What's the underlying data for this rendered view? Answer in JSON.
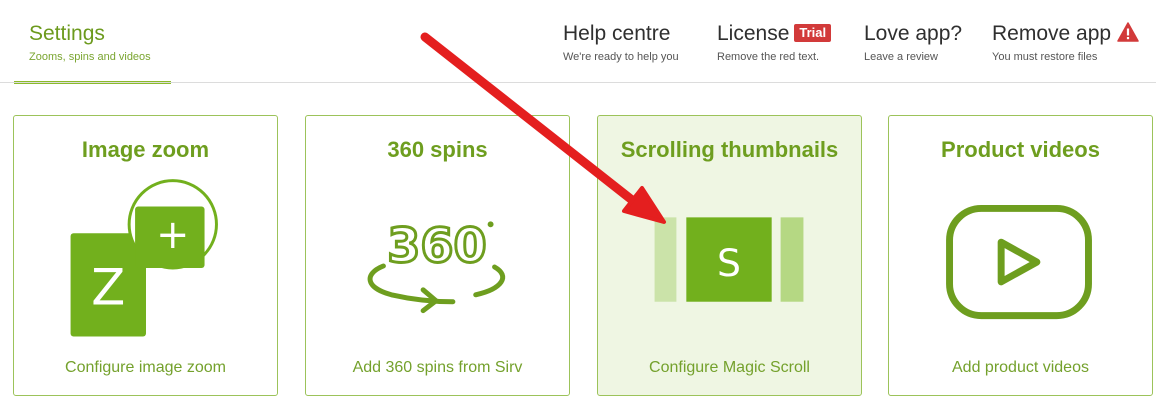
{
  "header": {
    "settings": {
      "title": "Settings",
      "subtitle": "Zooms, spins and videos"
    },
    "help": {
      "title": "Help centre",
      "subtitle": "We're ready to help you"
    },
    "license": {
      "title": "License",
      "badge": "Trial",
      "subtitle": "Remove the red text."
    },
    "love": {
      "title": "Love app?",
      "subtitle": "Leave a review"
    },
    "remove": {
      "title": "Remove app",
      "icon": "warning-icon",
      "subtitle": "You must restore files"
    }
  },
  "cards": [
    {
      "title": "Image zoom",
      "icon": "zoom-icon",
      "icon_letter": "Z",
      "icon_symbol": "+",
      "link": "Configure image zoom"
    },
    {
      "title": "360 spins",
      "icon": "spin-360-icon",
      "icon_text": "360",
      "link": "Add 360 spins from Sirv"
    },
    {
      "title": "Scrolling thumbnails",
      "icon": "scroll-thumbnails-icon",
      "icon_letter": "S",
      "link": "Configure Magic Scroll",
      "selected": true
    },
    {
      "title": "Product videos",
      "icon": "video-play-icon",
      "link": "Add product videos"
    }
  ],
  "colors": {
    "brand_green": "#6e9e1f",
    "icon_green": "#72b01d",
    "card_border": "#9cc35a",
    "selected_bg": "#eff6e3",
    "trial_red": "#d23a3a",
    "arrow_red": "#e41f1f"
  }
}
